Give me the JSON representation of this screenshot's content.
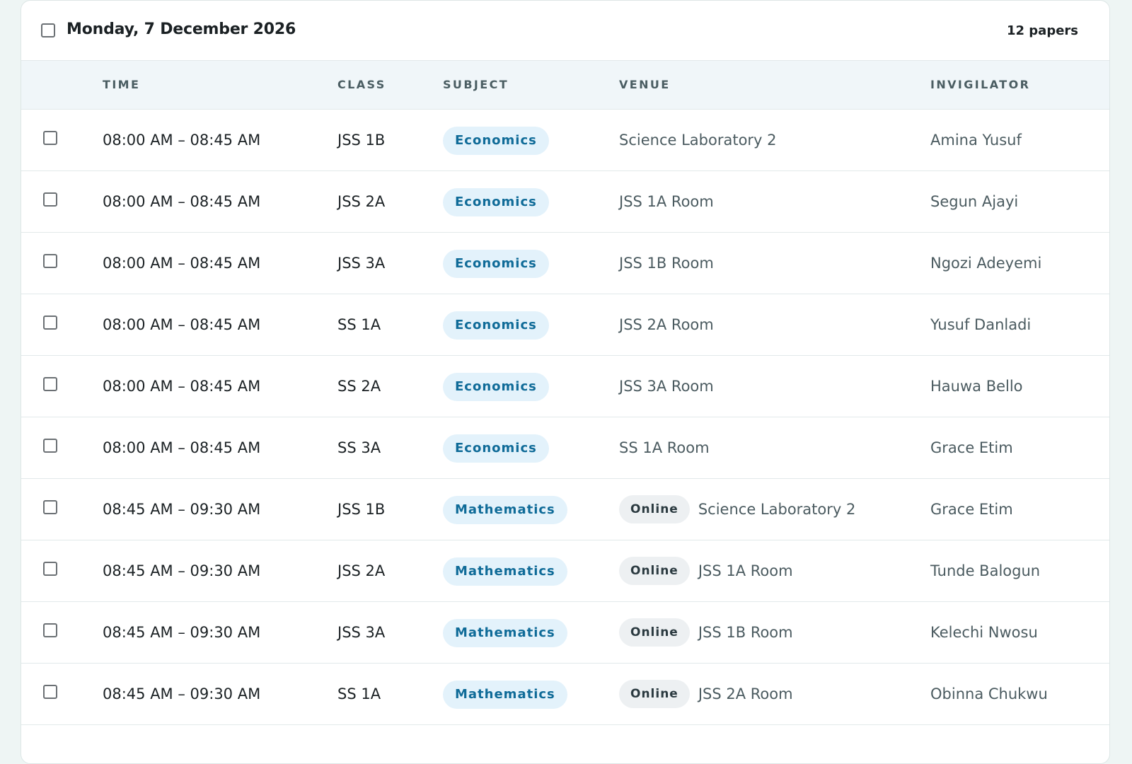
{
  "day": {
    "title": "Monday, 7 December 2026",
    "count": "12 papers"
  },
  "columns": {
    "time": "TIME",
    "class": "CLASS",
    "subject": "SUBJECT",
    "venue": "VENUE",
    "invigilator": "INVIGILATOR"
  },
  "rows": [
    {
      "time": "08:00 AM – 08:45 AM",
      "class": "JSS 1B",
      "subject": "Economics",
      "online": "",
      "venue": "Science Laboratory 2",
      "invigilator": "Amina Yusuf"
    },
    {
      "time": "08:00 AM – 08:45 AM",
      "class": "JSS 2A",
      "subject": "Economics",
      "online": "",
      "venue": "JSS 1A Room",
      "invigilator": "Segun Ajayi"
    },
    {
      "time": "08:00 AM – 08:45 AM",
      "class": "JSS 3A",
      "subject": "Economics",
      "online": "",
      "venue": "JSS 1B Room",
      "invigilator": "Ngozi Adeyemi"
    },
    {
      "time": "08:00 AM – 08:45 AM",
      "class": "SS 1A",
      "subject": "Economics",
      "online": "",
      "venue": "JSS 2A Room",
      "invigilator": "Yusuf Danladi"
    },
    {
      "time": "08:00 AM – 08:45 AM",
      "class": "SS 2A",
      "subject": "Economics",
      "online": "",
      "venue": "JSS 3A Room",
      "invigilator": "Hauwa Bello"
    },
    {
      "time": "08:00 AM – 08:45 AM",
      "class": "SS 3A",
      "subject": "Economics",
      "online": "",
      "venue": "SS 1A Room",
      "invigilator": "Grace Etim"
    },
    {
      "time": "08:45 AM – 09:30 AM",
      "class": "JSS 1B",
      "subject": "Mathematics",
      "online": "Online",
      "venue": "Science Laboratory 2",
      "invigilator": "Grace Etim"
    },
    {
      "time": "08:45 AM – 09:30 AM",
      "class": "JSS 2A",
      "subject": "Mathematics",
      "online": "Online",
      "venue": "JSS 1A Room",
      "invigilator": "Tunde Balogun"
    },
    {
      "time": "08:45 AM – 09:30 AM",
      "class": "JSS 3A",
      "subject": "Mathematics",
      "online": "Online",
      "venue": "JSS 1B Room",
      "invigilator": "Kelechi Nwosu"
    },
    {
      "time": "08:45 AM – 09:30 AM",
      "class": "SS 1A",
      "subject": "Mathematics",
      "online": "Online",
      "venue": "JSS 2A Room",
      "invigilator": "Obinna Chukwu"
    }
  ],
  "colors": {
    "subject_pill_bg": "#e3f2fb",
    "subject_pill_text": "#0f6b98",
    "online_pill_bg": "#edf0f2",
    "header_bg": "#f0f6f9",
    "page_bg": "#eef5f4"
  },
  "icons": {
    "checkbox": "checkbox-icon"
  }
}
